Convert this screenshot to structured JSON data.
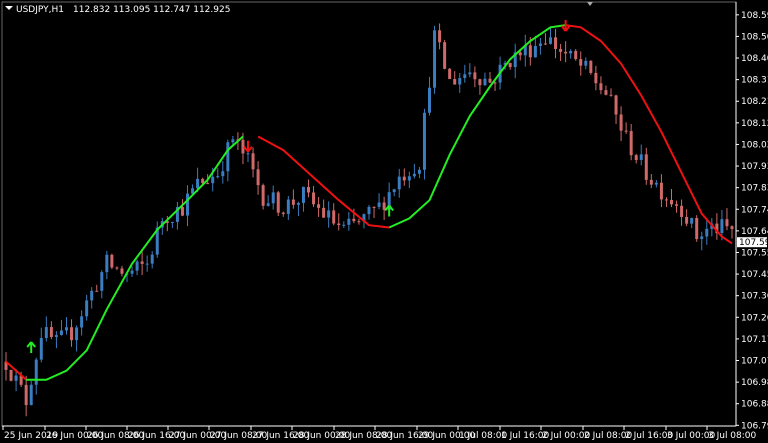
{
  "window": {
    "symbol": "USDJPY,H1",
    "ohlc": "112.832 113.095 112.747 112.925",
    "price_tag": "107.595"
  },
  "chart_data": {
    "type": "candlestick",
    "y_ticks": [
      "108.595",
      "108.500",
      "108.405",
      "108.310",
      "108.215",
      "108.120",
      "108.025",
      "107.930",
      "107.835",
      "107.740",
      "107.645",
      "107.550",
      "107.455",
      "107.360",
      "107.265",
      "107.170",
      "107.075",
      "106.980",
      "106.885",
      "106.790"
    ],
    "x_ticks": [
      "25 Jun 2019",
      "26 Jun 00:00",
      "26 Jun 08:00",
      "26 Jun 16:00",
      "27 Jun 00:00",
      "27 Jun 08:00",
      "27 Jun 16:00",
      "28 Jun 00:00",
      "28 Jun 08:00",
      "28 Jun 16:00",
      "29 Jun 00:00",
      "1 Jul 08:00",
      "1 Jul 16:00",
      "2 Jul 00:00",
      "2 Jul 08:00",
      "2 Jul 16:00",
      "3 Jul 00:00",
      "3 Jul 08:00"
    ],
    "ylim": [
      106.765,
      108.625
    ],
    "colors": {
      "bull": "#3a7dc0",
      "bear": "#d06a6a",
      "trend_up": "#22ee22",
      "trend_down": "#ee1111",
      "axis": "#ffffff",
      "tag_bg": "#ffffff"
    },
    "signals": [
      {
        "type": "buy",
        "index": 5,
        "price": 107.13
      },
      {
        "type": "sell",
        "index": 48,
        "price": 108.02
      },
      {
        "type": "buy",
        "index": 76,
        "price": 107.73
      },
      {
        "type": "sell",
        "index": 111,
        "price": 108.55
      }
    ]
  }
}
